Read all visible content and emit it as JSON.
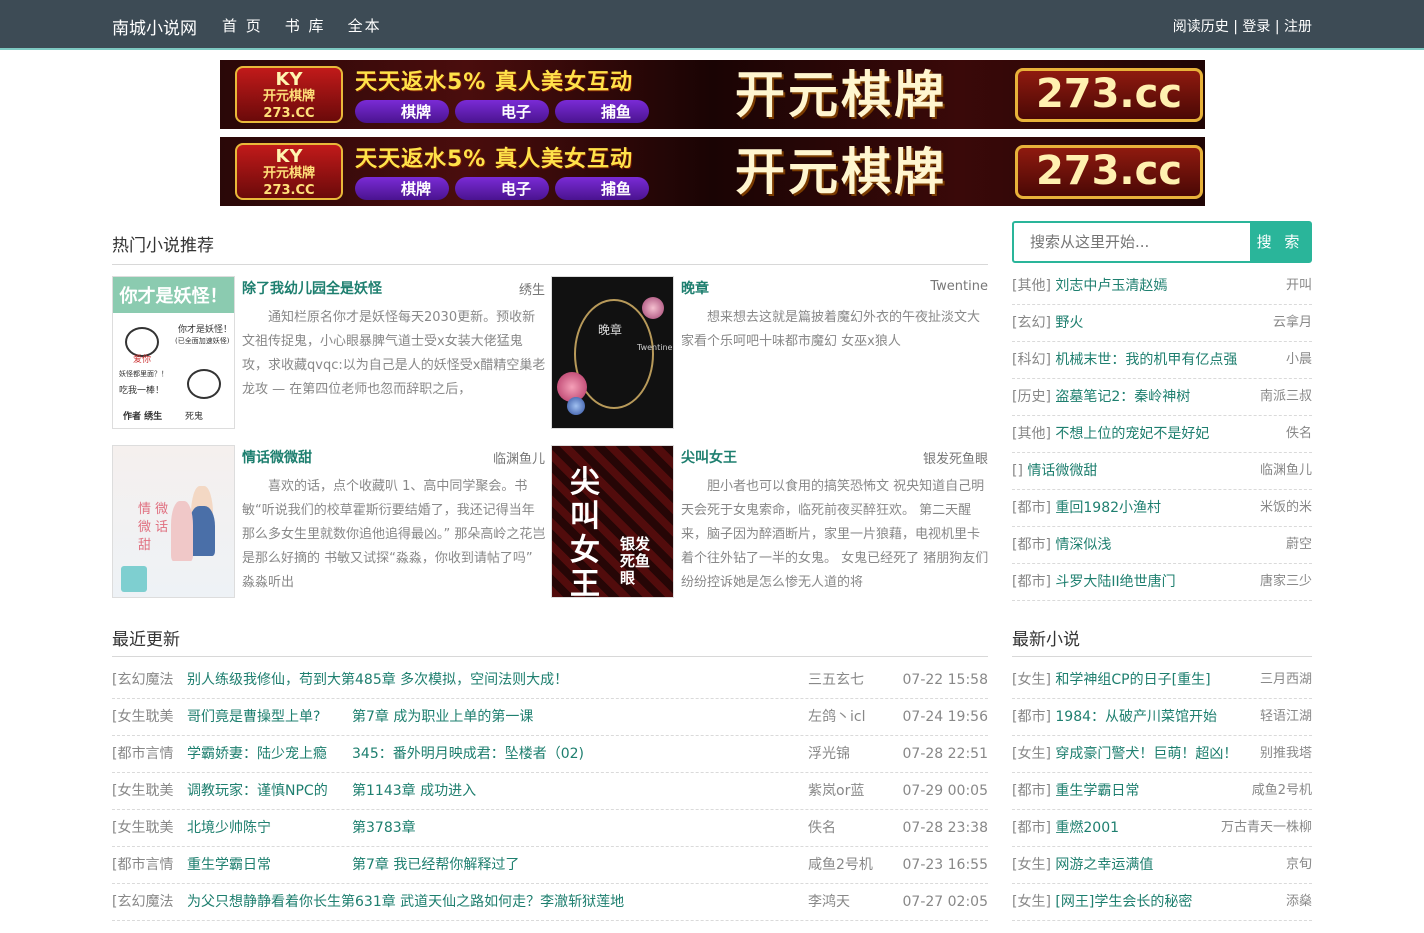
{
  "header": {
    "brand": "南城小说网",
    "nav": [
      "首 页",
      "书 库",
      "全本"
    ],
    "user_links": "阅读历史 | 登录 | 注册"
  },
  "banners": [
    {
      "logo_top": "KY",
      "logo_mid": "开元棋牌",
      "logo_bottom": "273.CC",
      "slogan": "天天返水5% 真人美女互动",
      "pills": [
        "棋牌",
        "电子",
        "捕鱼"
      ],
      "title": "开元棋牌",
      "url": "273.cc"
    },
    {
      "logo_top": "KY",
      "logo_mid": "开元棋牌",
      "logo_bottom": "273.CC",
      "slogan": "天天返水5% 真人美女互动",
      "pills": [
        "棋牌",
        "电子",
        "捕鱼"
      ],
      "title": "开元棋牌",
      "url": "273.cc"
    }
  ],
  "hot": {
    "title": "热门小说推荐",
    "cards": [
      {
        "title": "除了我幼儿园全是妖怪",
        "author": "绣生",
        "desc": "通知栏原名你才是妖怪每天2030更新。预收新文祖传捉鬼，小心眼暴脾气道士受x女装大佬猛鬼攻，求收藏qvqc:以为自己是人的妖怪受x醋精空巢老龙攻 — 在第四位老师也忽而辞职之后，",
        "cover": {
          "header": "你才是妖怪！",
          "line1": "你才是妖怪！",
          "line2": "(已全面加速妖怪)",
          "line3": "爱你",
          "line4": "妖怪都里面？！",
          "line5": "吃我一棒！",
          "author_tag": "作者 绣生",
          "tag2": "死鬼"
        }
      },
      {
        "title": "晚章",
        "author": "Twentine",
        "desc": "想来想去这就是篇披着魔幻外衣的午夜扯淡文大家看个乐呵吧十味都市魔幻 女巫x狼人",
        "cover": {
          "title": "晚章",
          "sub": "Twentine"
        }
      },
      {
        "title": "情话微微甜",
        "author": "临渊鱼儿",
        "desc": "喜欢的话，点个收藏叭 1、高中同学聚会。书敏“听说我们的校草霍斯衍要结婚了，我还记得当年那么多女生里就数你追他追得最凶。” 那朵高岭之花岂是那么好摘的 书敏又试探“淼淼，你收到请帖了吗” 淼淼听出",
        "cover": {
          "title": "情 微 微 话 甜"
        }
      },
      {
        "title": "尖叫女王",
        "author": "银发死鱼眼",
        "desc": "胆小者也可以食用的搞笑恐怖文 祝央知道自己明天会死于女鬼索命，临死前夜买醉狂欢。 第二天醒来，脑子因为醉酒断片，家里一片狼藉，电视机里卡着个往外钻了一半的女鬼。 女鬼已经死了 猪朋狗友们纷纷控诉她是怎么惨无人道的将",
        "cover": {
          "title": "尖 叫 女 王",
          "sub": "银发 死鱼眼"
        }
      }
    ]
  },
  "search": {
    "placeholder": "搜索从这里开始...",
    "button": "搜 索"
  },
  "side_hot": [
    {
      "cat": "[其他]",
      "title": "刘志中卢玉清赵嫣",
      "author": "开叫"
    },
    {
      "cat": "[玄幻]",
      "title": "野火",
      "author": "云拿月"
    },
    {
      "cat": "[科幻]",
      "title": "机械末世：我的机甲有亿点强",
      "author": "小晨"
    },
    {
      "cat": "[历史]",
      "title": "盗墓笔记2：秦岭神树",
      "author": "南派三叔"
    },
    {
      "cat": "[其他]",
      "title": "不想上位的宠妃不是好妃",
      "author": "佚名"
    },
    {
      "cat": "[]",
      "title": "情话微微甜",
      "author": "临渊鱼儿"
    },
    {
      "cat": "[都市]",
      "title": "重回1982小渔村",
      "author": "米饭的米"
    },
    {
      "cat": "[都市]",
      "title": "情深似浅",
      "author": "蔚空"
    },
    {
      "cat": "[都市]",
      "title": "斗罗大陆II绝世唐门",
      "author": "唐家三少"
    }
  ],
  "recent": {
    "title": "最近更新",
    "rows": [
      {
        "cat": "[玄幻魔法",
        "book": "别人练级我修仙，苟到大第485章 多次模拟，空间法则大成！",
        "chapter": "",
        "author": "三五玄七",
        "time": "07-22 15:58"
      },
      {
        "cat": "[女生耽美",
        "book": "哥们竟是曹操型上单?",
        "chapter": "第7章 成为职业上单的第一课",
        "author": "左鸽丶icl",
        "time": "07-24 19:56"
      },
      {
        "cat": "[都市言情",
        "book": "学霸娇妻：陆少宠上瘾",
        "chapter": "345：番外明月映成君：坠楼者（02)",
        "author": "浮光锦",
        "time": "07-28 22:51"
      },
      {
        "cat": "[女生耽美",
        "book": "调教玩家：谨慎NPC的",
        "chapter": "第1143章 成功进入",
        "author": "紫岚or蓝",
        "time": "07-29 00:05"
      },
      {
        "cat": "[女生耽美",
        "book": "北境少帅陈宁",
        "chapter": "第3783章",
        "author": "佚名",
        "time": "07-28 23:38"
      },
      {
        "cat": "[都市言情",
        "book": "重生学霸日常",
        "chapter": "第7章 我已经帮你解释过了",
        "author": "咸鱼2号机",
        "time": "07-23 16:55"
      },
      {
        "cat": "[玄幻魔法",
        "book": "为父只想静静看着你长生第631章 武道天仙之路如何走？李澈斩狱莲地",
        "chapter": "",
        "author": "李鸿天",
        "time": "07-27 02:05"
      }
    ]
  },
  "latest": {
    "title": "最新小说",
    "rows": [
      {
        "cat": "[女生]",
        "title": "和学神组CP的日子[重生]",
        "author": "三月西湖"
      },
      {
        "cat": "[都市]",
        "title": "1984：从破产川菜馆开始",
        "author": "轻语江湖"
      },
      {
        "cat": "[女生]",
        "title": "穿成豪门警犬！巨萌！超凶！",
        "author": "别推我塔"
      },
      {
        "cat": "[都市]",
        "title": "重生学霸日常",
        "author": "咸鱼2号机"
      },
      {
        "cat": "[都市]",
        "title": "重燃2001",
        "author": "万古青天一株柳"
      },
      {
        "cat": "[女生]",
        "title": "网游之幸运满值",
        "author": "京旬"
      },
      {
        "cat": "[女生]",
        "title": "[网王]学生会长的秘密",
        "author": "添燊"
      }
    ]
  },
  "colors": {
    "topbar": "#3d4b55",
    "accent": "#2ab59a",
    "link": "#1e7f6f"
  }
}
